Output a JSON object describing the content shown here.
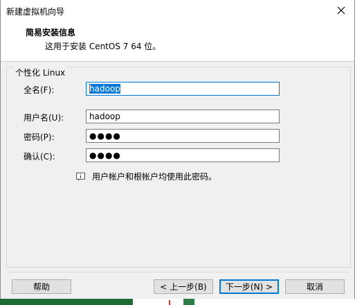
{
  "window": {
    "title": "新建虚拟机向导",
    "close_glyph": "✕"
  },
  "header": {
    "title": "简易安装信息",
    "subtitle": "这用于安装 CentOS 7 64 位。"
  },
  "personalize": {
    "group_title": "个性化 Linux",
    "full_name_label": "全名(F):",
    "full_name_value": "hadoop",
    "user_name_label": "用户名(U):",
    "user_name_value": "hadoop",
    "password_label": "密码(P):",
    "password_value": "●●●●",
    "confirm_label": "确认(C):",
    "confirm_value": "●●●●",
    "info_text": "用户帐户和根帐户均使用此密码。"
  },
  "buttons": {
    "help": "帮助",
    "back": "< 上一步(B)",
    "next": "下一步(N) >",
    "cancel": "取消"
  },
  "colors": {
    "accent": "#0078d7"
  }
}
